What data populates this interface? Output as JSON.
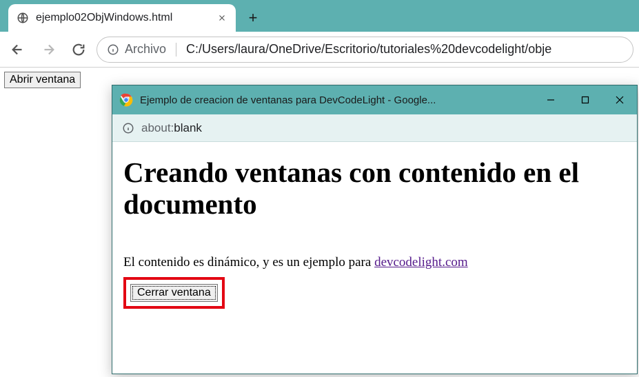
{
  "browser": {
    "tab": {
      "title": "ejemplo02ObjWindows.html"
    },
    "address": {
      "file_label": "Archivo",
      "url": "C:/Users/laura/OneDrive/Escritorio/tutoriales%20devcodelight/obje"
    }
  },
  "page": {
    "open_button_label": "Abrir ventana"
  },
  "popup": {
    "titlebar": "Ejemplo de creacion de ventanas para DevCodeLight - Google...",
    "address": {
      "protocol": "about:",
      "rest": "blank"
    },
    "heading": "Creando ventanas con contenido en el documento",
    "paragraph": "El contenido es dinámico, y es un ejemplo para ",
    "link_text": "devcodelight.com",
    "close_button_label": "Cerrar ventana"
  }
}
